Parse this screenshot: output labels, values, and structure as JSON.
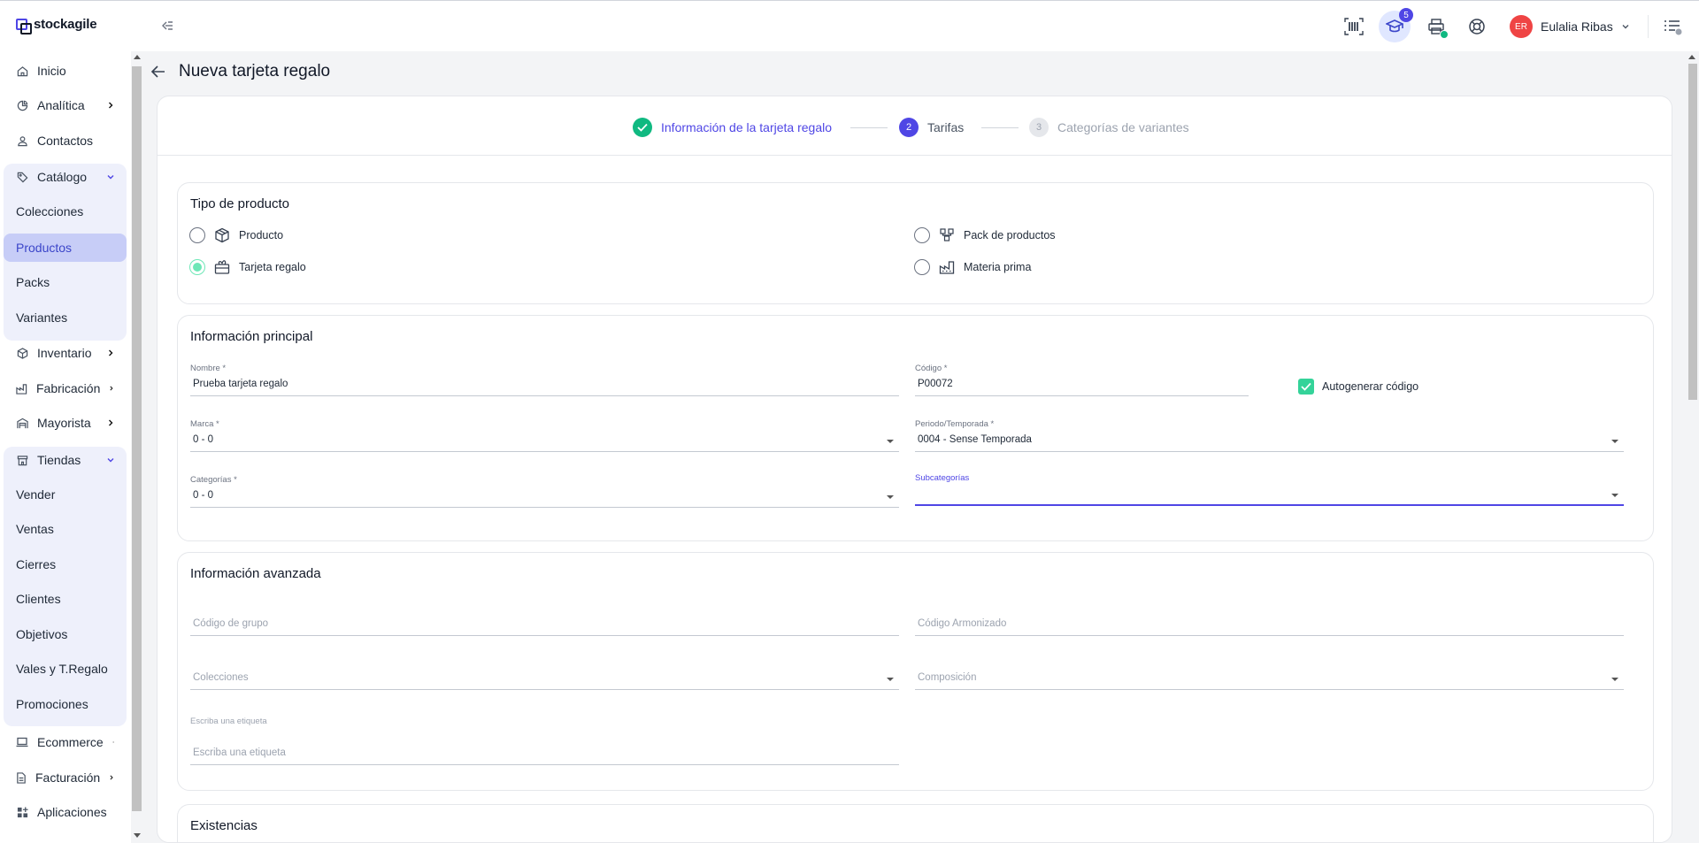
{
  "app": {
    "brand": "stockagile"
  },
  "topbar": {
    "notifications_count": "5",
    "user_initials": "ER",
    "user_name": "Eulalia Ribas"
  },
  "sidebar": {
    "items": [
      {
        "label": "Inicio"
      },
      {
        "label": "Analítica"
      },
      {
        "label": "Contactos"
      },
      {
        "label": "Catálogo"
      },
      {
        "label": "Colecciones"
      },
      {
        "label": "Productos"
      },
      {
        "label": "Packs"
      },
      {
        "label": "Variantes"
      },
      {
        "label": "Inventario"
      },
      {
        "label": "Fabricación"
      },
      {
        "label": "Mayorista"
      },
      {
        "label": "Tiendas"
      },
      {
        "label": "Vender"
      },
      {
        "label": "Ventas"
      },
      {
        "label": "Cierres"
      },
      {
        "label": "Clientes"
      },
      {
        "label": "Objetivos"
      },
      {
        "label": "Vales y T.Regalo"
      },
      {
        "label": "Promociones"
      },
      {
        "label": "Ecommerce"
      },
      {
        "label": "Facturación"
      },
      {
        "label": "Aplicaciones"
      }
    ]
  },
  "page": {
    "title": "Nueva tarjeta regalo"
  },
  "stepper": {
    "steps": [
      {
        "number": "1",
        "label": "Información de la tarjeta regalo",
        "state": "done"
      },
      {
        "number": "2",
        "label": "Tarifas",
        "state": "current"
      },
      {
        "number": "3",
        "label": "Categorías de variantes",
        "state": "pending"
      }
    ]
  },
  "product_type": {
    "title": "Tipo de producto",
    "options": [
      {
        "label": "Producto",
        "selected": false
      },
      {
        "label": "Pack de productos",
        "selected": false
      },
      {
        "label": "Tarjeta regalo",
        "selected": true
      },
      {
        "label": "Materia prima",
        "selected": false
      }
    ]
  },
  "main_info": {
    "title": "Información principal",
    "nombre": {
      "label": "Nombre *",
      "value": "Prueba tarjeta regalo"
    },
    "codigo": {
      "label": "Código *",
      "value": "P00072"
    },
    "autogenerar": {
      "label": "Autogenerar código",
      "checked": true
    },
    "marca": {
      "label": "Marca *",
      "value": "0 - 0"
    },
    "periodo": {
      "label": "Periodo/Temporada *",
      "value": "0004 - Sense Temporada"
    },
    "categorias": {
      "label": "Categorías *",
      "value": "0 - 0"
    },
    "subcategorias": {
      "label": "Subcategorías",
      "value": ""
    }
  },
  "advanced_info": {
    "title": "Información avanzada",
    "codigo_grupo": {
      "placeholder": "Código de grupo"
    },
    "codigo_armonizado": {
      "placeholder": "Código Armonizado"
    },
    "colecciones": {
      "placeholder": "Colecciones"
    },
    "composicion": {
      "placeholder": "Composición"
    },
    "etiqueta": {
      "label": "Escriba una etiqueta",
      "placeholder": "Escriba una etiqueta"
    }
  },
  "stock": {
    "title": "Existencias"
  },
  "colors": {
    "accent": "#4f46e5",
    "success": "#10b981",
    "radio_checked": "#6ee7b7"
  }
}
